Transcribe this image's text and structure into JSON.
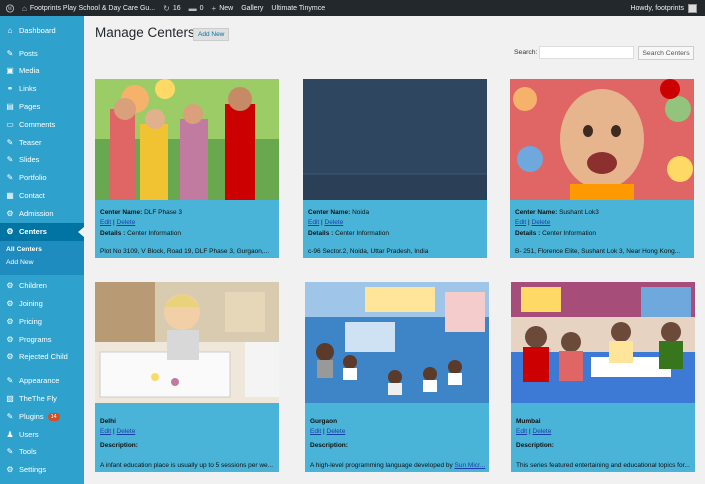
{
  "adminbar": {
    "site": "Footprints Play School & Day Care Gu...",
    "updates": "16",
    "comments": "0",
    "new": "New",
    "gallery": "Gallery",
    "tinymce": "Ultimate Tinymce",
    "howdy": "Howdy, footprints"
  },
  "menu": [
    {
      "label": "Dashboard",
      "icon": "⌂"
    },
    {
      "label": "Posts",
      "icon": "✎"
    },
    {
      "label": "Media",
      "icon": "▣"
    },
    {
      "label": "Links",
      "icon": "⚭"
    },
    {
      "label": "Pages",
      "icon": "▤"
    },
    {
      "label": "Comments",
      "icon": "▭"
    },
    {
      "label": "Teaser",
      "icon": "✎"
    },
    {
      "label": "Slides",
      "icon": "✎"
    },
    {
      "label": "Portfolio",
      "icon": "✎"
    },
    {
      "label": "Contact",
      "icon": "▦"
    },
    {
      "label": "Admission",
      "icon": "⚙"
    },
    {
      "label": "Centers",
      "icon": "⚙"
    },
    {
      "label": "Children",
      "icon": "⚙"
    },
    {
      "label": "Joining",
      "icon": "⚙"
    },
    {
      "label": "Pricing",
      "icon": "⚙"
    },
    {
      "label": "Programs",
      "icon": "⚙"
    },
    {
      "label": "Rejected Child",
      "icon": "⚙"
    },
    {
      "label": "Appearance",
      "icon": "✎"
    },
    {
      "label": "TheThe Fly",
      "icon": "▧"
    },
    {
      "label": "Plugins",
      "icon": "✎",
      "badge": "14"
    },
    {
      "label": "Users",
      "icon": "♟"
    },
    {
      "label": "Tools",
      "icon": "✎"
    },
    {
      "label": "Settings",
      "icon": "⚙"
    }
  ],
  "submenu": {
    "all": "All Centers",
    "add": "Add New"
  },
  "page": {
    "title": "Manage Centers",
    "add_new": "Add New",
    "search_label": "Search:",
    "search_button": "Search Centers",
    "search_value": ""
  },
  "link_edit": "Edit",
  "link_delete": "Delete",
  "link_sep": " | ",
  "cards": [
    {
      "name_label": "Center Name:",
      "name": "DLF Phase 3",
      "det_label": "Details :",
      "det": "Center Information",
      "addr": "Plot No 3109, V Block, Road 19, DLF Phase 3, Gurgaon,..."
    },
    {
      "name_label": "Center Name:",
      "name": "Noida",
      "det_label": "Details :",
      "det": "Center Information",
      "addr": "c-96 Sector.2, Noida, Uttar Pradesh, India"
    },
    {
      "name_label": "Center Name:",
      "name": "Sushant Lok3",
      "det_label": "Details :",
      "det": "Center Information",
      "addr": "B- 251, Florence Elite, Sushant Lok 3, Near Hong Kong..."
    },
    {
      "name": "Delhi",
      "det_label": "Description:",
      "addr": "A infant education place is usually up to 5 sessions per we..."
    },
    {
      "name": "Gurgaon",
      "det_label": "Description:",
      "addr": "A high-level programming language developed by",
      "addr_link": "Sun Micr..."
    },
    {
      "name": "Mumbai",
      "det_label": "Description:",
      "addr": "This series featured entertaining and educational topics for..."
    }
  ]
}
